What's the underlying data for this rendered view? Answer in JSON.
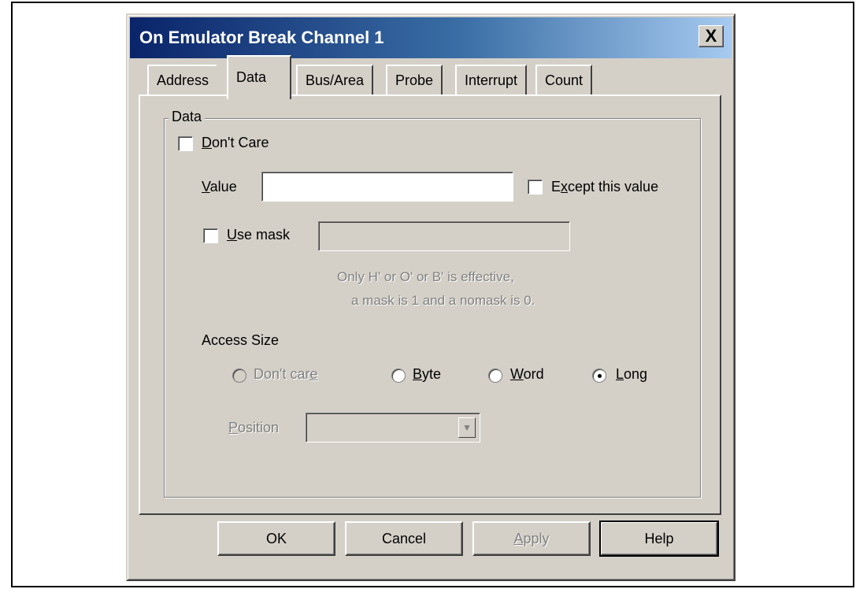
{
  "window": {
    "title": "On Emulator Break Channel 1",
    "close_glyph": "X"
  },
  "tabs": [
    {
      "label": "Address",
      "active": false
    },
    {
      "label": "Data",
      "active": true
    },
    {
      "label": "Bus/Area",
      "active": false
    },
    {
      "label": "Probe",
      "active": false
    },
    {
      "label": "Interrupt",
      "active": false
    },
    {
      "label": "Count",
      "active": false
    }
  ],
  "data_group": {
    "label": "Data",
    "dont_care": {
      "label_mnemonic": "D",
      "label_rest": "on't Care",
      "checked": false
    },
    "value": {
      "label_mnemonic": "V",
      "label_rest": "alue",
      "value": ""
    },
    "except_value": {
      "label_pre": "E",
      "label_mnemonic": "x",
      "label_rest": "cept this value",
      "checked": false
    },
    "use_mask": {
      "label_mnemonic": "U",
      "label_rest": "se mask",
      "checked": false,
      "value": ""
    },
    "hint_line1": "Only H' or O' or B' is effective,",
    "hint_line2": "a mask is 1 and a nomask is 0.",
    "access_size": {
      "label": "Access Size",
      "options": [
        {
          "pre": "Don't car",
          "mnemonic": "e",
          "post": "",
          "selected": false,
          "enabled": false
        },
        {
          "pre": "",
          "mnemonic": "B",
          "post": "yte",
          "selected": false,
          "enabled": true
        },
        {
          "pre": "",
          "mnemonic": "W",
          "post": "ord",
          "selected": false,
          "enabled": true
        },
        {
          "pre": "",
          "mnemonic": "L",
          "post": "ong",
          "selected": true,
          "enabled": true
        }
      ]
    },
    "position": {
      "label_mnemonic": "P",
      "label_rest": "osition",
      "value": "",
      "enabled": false
    }
  },
  "buttons": {
    "ok": "OK",
    "cancel": "Cancel",
    "apply_mnemonic": "A",
    "apply_rest": "pply",
    "help": "Help"
  },
  "colors": {
    "dialog_bg": "#d4d0c8",
    "title_gradient_start": "#0a246a",
    "title_gradient_end": "#a6caf0",
    "disabled_text": "#808080"
  }
}
